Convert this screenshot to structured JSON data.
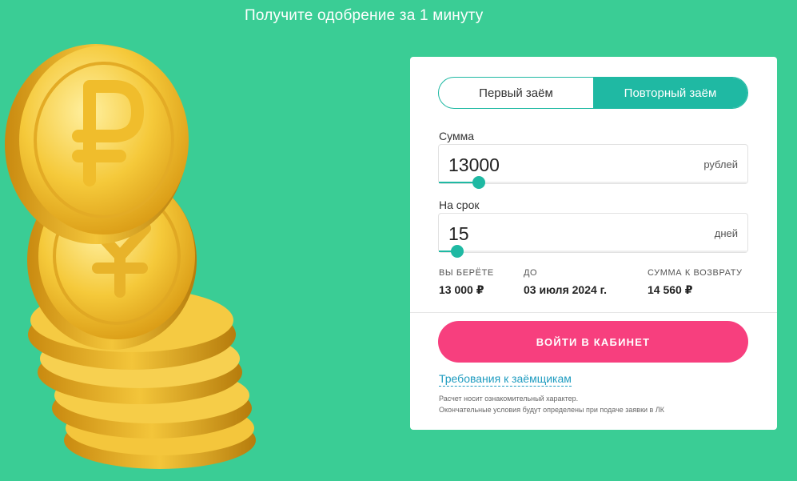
{
  "headline": "Получите одобрение за 1 минуту",
  "tabs": [
    {
      "label": "Первый заём",
      "active": false
    },
    {
      "label": "Повторный заём",
      "active": true
    }
  ],
  "amount": {
    "label": "Сумма",
    "value": "13000",
    "unit": "рублей",
    "slider_fraction": 0.13
  },
  "term": {
    "label": "На срок",
    "value": "15",
    "unit": "дней",
    "slider_fraction": 0.06
  },
  "summary": {
    "you_take": {
      "caption": "ВЫ БЕРЁТЕ",
      "value": "13 000 ₽"
    },
    "until": {
      "caption": "ДО",
      "value": "03 июля 2024 г."
    },
    "repay": {
      "caption": "СУММА К ВОЗВРАТУ",
      "value": "14 560 ₽"
    }
  },
  "cta_label": "ВОЙТИ В КАБИНЕТ",
  "requirements_link": "Требования к заёмщикам",
  "disclaimer": [
    "Расчет носит ознакомительный характер.",
    "Окончательные условия будут определены при подаче заявки в ЛК"
  ],
  "colors": {
    "background": "#3acd95",
    "accent": "#1fb9a3",
    "cta": "#f73f7e",
    "link": "#1f9cc0",
    "coin": "#f2c12e"
  },
  "icons": [
    "ruble-coin-stack-illustration"
  ]
}
